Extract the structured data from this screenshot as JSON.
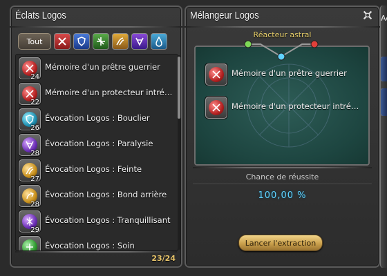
{
  "left": {
    "title": "Éclats Logos",
    "tab_all_label": "Tout",
    "category_tabs": [
      {
        "icon": "sword-icon",
        "color": "#b52a2a"
      },
      {
        "icon": "shield-icon",
        "color": "#2a5ab5"
      },
      {
        "icon": "heal-icon",
        "color": "#3a8a2a"
      },
      {
        "icon": "feint-icon",
        "color": "#c08a1a"
      },
      {
        "icon": "paralysis-icon",
        "color": "#6a2ab5"
      },
      {
        "icon": "water-icon",
        "color": "#2a8ab5"
      }
    ],
    "items": [
      {
        "label": "Mémoire d'un prêtre guerrier",
        "count": "24",
        "color": "#b52222",
        "icon": "swords-icon"
      },
      {
        "label": "Mémoire d'un protecteur intré…",
        "count": "22",
        "color": "#b52222",
        "icon": "swords-icon"
      },
      {
        "label": "Évocation Logos : Bouclier",
        "count": "26",
        "color": "#1f8fb0",
        "icon": "shield-icon"
      },
      {
        "label": "Évocation Logos : Paralysie",
        "count": "28",
        "color": "#6b2fb5",
        "icon": "paralysis-icon"
      },
      {
        "label": "Évocation Logos : Feinte",
        "count": "27",
        "color": "#c8901c",
        "icon": "feint-icon"
      },
      {
        "label": "Évocation Logos : Bond arrière",
        "count": "28",
        "color": "#c8901c",
        "icon": "leap-icon"
      },
      {
        "label": "Évocation Logos : Tranquillisant",
        "count": "29",
        "color": "#6b2fb5",
        "icon": "tranquilizer-icon"
      },
      {
        "label": "Évocation Logos : Soin",
        "count": "",
        "color": "#2f9a2f",
        "icon": "heal-icon"
      }
    ],
    "counter": "23/24"
  },
  "right": {
    "title": "Mélangeur Logos",
    "reactor_label": "Réacteur astral",
    "reactor_colors": [
      "#7ed957",
      "#5fd2ff",
      "#e0403a"
    ],
    "slots": [
      {
        "label": "Mémoire d'un prêtre guerrier",
        "color": "#b52222",
        "icon": "swords-icon"
      },
      {
        "label": "Mémoire d'un protecteur intré…",
        "color": "#b52222",
        "icon": "swords-icon"
      }
    ],
    "chance_label": "Chance de réussite",
    "chance_value": "100,00 %",
    "extract_label": "Lancer l'extraction"
  },
  "edge": {
    "partial_label": "Ae"
  }
}
